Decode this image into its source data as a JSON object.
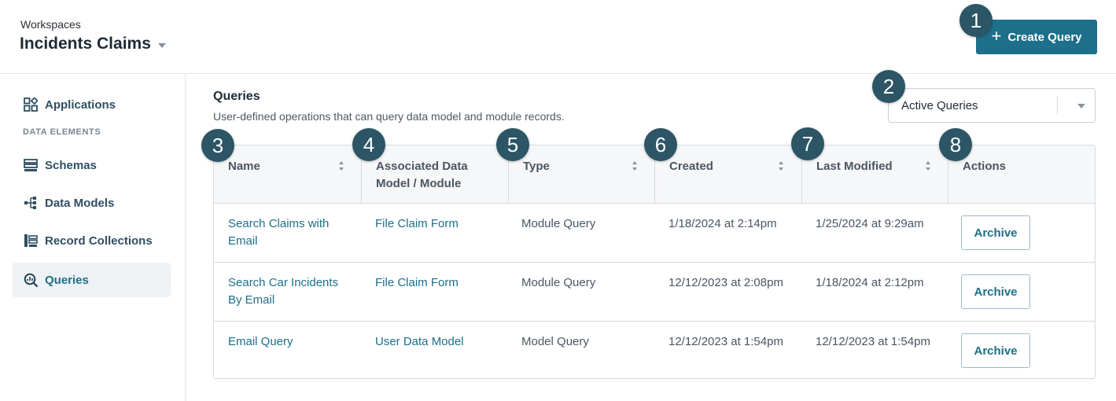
{
  "header": {
    "workspace_label": "Workspaces",
    "workspace_name": "Incidents Claims",
    "create_button": "Create Query"
  },
  "sidebar": {
    "section_label": "DATA ELEMENTS",
    "items": [
      {
        "label": "Applications",
        "icon": "applications-icon"
      },
      {
        "label": "Schemas",
        "icon": "schemas-icon"
      },
      {
        "label": "Data Models",
        "icon": "data-models-icon"
      },
      {
        "label": "Record Collections",
        "icon": "record-collections-icon"
      },
      {
        "label": "Queries",
        "icon": "queries-icon",
        "active": true
      }
    ]
  },
  "main": {
    "title": "Queries",
    "subtitle": "User-defined operations that can query data model and module records.",
    "filter": {
      "selected": "Active Queries"
    }
  },
  "table": {
    "columns": [
      {
        "label": "Name",
        "sortable": true
      },
      {
        "label": "Associated Data Model / Module",
        "line1": "Associated Data",
        "line2": "Model / Module",
        "sortable": false
      },
      {
        "label": "Type",
        "sortable": true
      },
      {
        "label": "Created",
        "sortable": true
      },
      {
        "label": "Last Modified",
        "sortable": true
      },
      {
        "label": "Actions",
        "sortable": false
      }
    ],
    "rows": [
      {
        "name_line1": "Search Claims with",
        "name_line2": "Email",
        "assoc": "File Claim Form",
        "type": "Module Query",
        "created": "1/18/2024 at 2:14pm",
        "modified": "1/25/2024 at 9:29am",
        "action": "Archive"
      },
      {
        "name_line1": "Search Car Incidents",
        "name_line2": "By Email",
        "assoc": "File Claim Form",
        "type": "Module Query",
        "created": "12/12/2023 at 2:08pm",
        "modified": "1/18/2024 at 2:12pm",
        "action": "Archive"
      },
      {
        "name_line1": "Email Query",
        "name_line2": "",
        "assoc": "User Data Model",
        "type": "Model Query",
        "created": "12/12/2023 at 1:54pm",
        "modified": "12/12/2023 at 1:54pm",
        "action": "Archive"
      }
    ]
  },
  "callouts": [
    "1",
    "2",
    "3",
    "4",
    "5",
    "6",
    "7",
    "8"
  ],
  "colors": {
    "accent": "#1d6f8a",
    "badge": "#2c5565"
  }
}
